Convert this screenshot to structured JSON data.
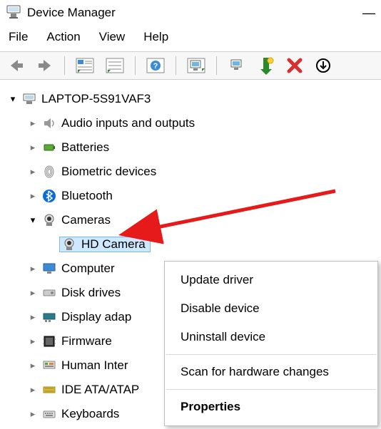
{
  "window": {
    "title": "Device Manager"
  },
  "menubar": {
    "file": "File",
    "action": "Action",
    "view": "View",
    "help": "Help"
  },
  "root": {
    "label": "LAPTOP-5S91VAF3"
  },
  "nodes": {
    "audio": "Audio inputs and outputs",
    "batteries": "Batteries",
    "biometric": "Biometric devices",
    "bluetooth": "Bluetooth",
    "cameras": "Cameras",
    "hdcamera": "HD Camera",
    "computer": "Computer",
    "disk": "Disk drives",
    "display": "Display adap",
    "firmware": "Firmware",
    "hid": "Human Inter",
    "ide": "IDE ATA/ATAP",
    "keyboards": "Keyboards"
  },
  "context": {
    "update": "Update driver",
    "disable": "Disable device",
    "uninstall": "Uninstall device",
    "scan": "Scan for hardware changes",
    "properties": "Properties"
  }
}
